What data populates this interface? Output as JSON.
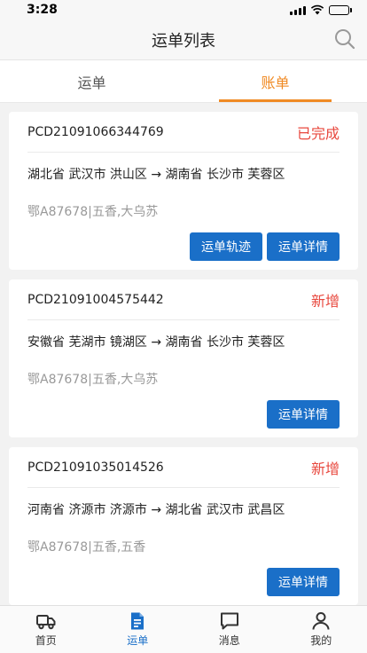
{
  "status_bar": {
    "time": "3:28"
  },
  "header": {
    "title": "运单列表"
  },
  "tabs": [
    {
      "label": "运单"
    },
    {
      "label": "账单",
      "active": true
    }
  ],
  "orders": [
    {
      "order_no": "PCD21091066344769",
      "status": "已完成",
      "route": "湖北省 武汉市 洪山区 → 湖南省 长沙市 芙蓉区",
      "vehicle": "鄂A87678|五香,大乌苏",
      "buttons": [
        "运单轨迹",
        "运单详情"
      ]
    },
    {
      "order_no": "PCD21091004575442",
      "status": "新增",
      "route": "安徽省 芜湖市 镜湖区 → 湖南省 长沙市 芙蓉区",
      "vehicle": "鄂A87678|五香,大乌苏",
      "buttons": [
        "运单详情"
      ]
    },
    {
      "order_no": "PCD21091035014526",
      "status": "新增",
      "route": "河南省 济源市 济源市 → 湖北省 武汉市 武昌区",
      "vehicle": "鄂A87678|五香,五香",
      "buttons": [
        "运单详情"
      ]
    }
  ],
  "tabbar": [
    {
      "label": "首页",
      "icon": "truck-icon"
    },
    {
      "label": "运单",
      "icon": "document-icon",
      "active": true
    },
    {
      "label": "消息",
      "icon": "message-icon"
    },
    {
      "label": "我的",
      "icon": "user-icon"
    }
  ],
  "colors": {
    "accent": "#f08a24",
    "primary": "#1a6fc8",
    "status_red": "#e8483e"
  }
}
